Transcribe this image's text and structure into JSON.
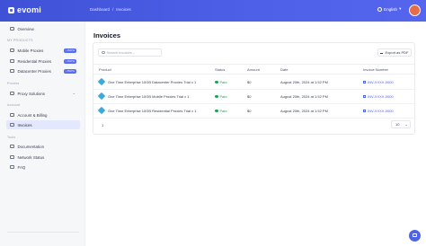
{
  "brand": {
    "name": "evomi"
  },
  "breadcrumb": [
    "Dashboard",
    "/",
    "Invoices"
  ],
  "language": {
    "label": "English"
  },
  "sidebar": {
    "overview": "Overview",
    "sections": {
      "products": "MY PRODUCTS",
      "proxies": "Proxies",
      "account": "Account",
      "tools": "Tools"
    },
    "items": [
      {
        "label": "Mobile Proxies",
        "badge": "• PAYG"
      },
      {
        "label": "Residential Proxies",
        "badge": "• PAYG"
      },
      {
        "label": "Datacenter Proxies",
        "badge": "• PAYG"
      },
      {
        "label": "Proxy Solutions"
      },
      {
        "label": "Account & Billing"
      },
      {
        "label": "Invoices"
      },
      {
        "label": "Documentation"
      },
      {
        "label": "Network Status"
      },
      {
        "label": "FAQ"
      }
    ]
  },
  "page": {
    "title": "Invoices"
  },
  "toolbar": {
    "search_placeholder": "Search invoices...",
    "export_label": "Export as PDF"
  },
  "table": {
    "headers": [
      "Product",
      "Status",
      "Amount",
      "Date",
      "Invoice Number"
    ],
    "rows": [
      {
        "product": "One Time Enterprise 10GB Datacenter Proxies Trial x 1",
        "status": "Paid",
        "amount": "$0",
        "date": "August 20th, 2024 at 1:52 PM",
        "invoice": "INV-XXXX-0000"
      },
      {
        "product": "One Time Enterprise 10GB Mobile Proxies Trial x 1",
        "status": "Paid",
        "amount": "$0",
        "date": "August 20th, 2024 at 1:52 PM",
        "invoice": "INV-XXXX-0000"
      },
      {
        "product": "One Time Enterprise 10GB Residential Proxies Trial x 1",
        "status": "Paid",
        "amount": "$0",
        "date": "August 20th, 2024 at 1:52 PM",
        "invoice": "INV-XXXX-0000"
      }
    ]
  },
  "pagination": {
    "page": "1",
    "per_page": "10"
  },
  "colors": {
    "brand": "#4e60e8",
    "paid": "#22a35a",
    "active_nav_bg": "#e4e8ff"
  }
}
